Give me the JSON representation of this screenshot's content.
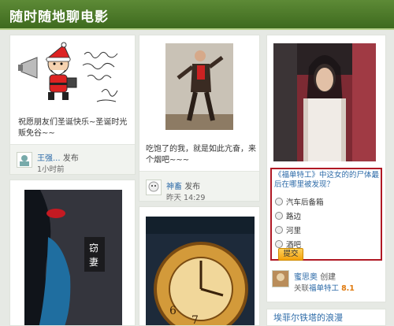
{
  "header": {
    "title": "随时随地聊电影"
  },
  "card1": {
    "caption": "祝愿朋友们圣诞快乐~圣诞时光贩免谷~~",
    "user": "王强...",
    "action": "发布",
    "time": "1小时前"
  },
  "card2": {
    "caption": "吃饱了的我，就是如此亢奋，来个烟吧~~~",
    "user": "神畜",
    "action": "发布",
    "time": "昨天 14:29"
  },
  "card3": {
    "question": "《福单特工》中这女的的尸体最后在哪里被发现？",
    "options": [
      "汽车后备箱",
      "路边",
      "河里",
      "酒吧"
    ],
    "submit_label": "提交",
    "user": "蜜思奥",
    "action": "创建",
    "related_prefix": "关联",
    "related_movie": "福单特工",
    "rating": "8.1"
  },
  "card6": {
    "title": "埃菲尔铁塔的浪漫"
  },
  "icons": {
    "santa": "santa-illustration",
    "poll": "poll-radio-icon"
  }
}
